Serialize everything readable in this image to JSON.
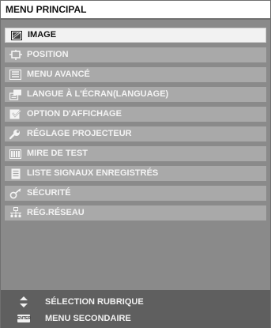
{
  "title": "MENU PRINCIPAL",
  "menu": {
    "items": [
      {
        "label": "IMAGE",
        "icon": "image-icon",
        "selected": true
      },
      {
        "label": "POSITION",
        "icon": "position-icon"
      },
      {
        "label": "MENU AVANCÉ",
        "icon": "advanced-menu-icon"
      },
      {
        "label": "LANGUE À L'ÉCRAN(LANGUAGE)",
        "icon": "language-icon"
      },
      {
        "label": "OPTION D'AFFICHAGE",
        "icon": "display-option-icon"
      },
      {
        "label": "RÉGLAGE PROJECTEUR",
        "icon": "projector-setting-icon"
      },
      {
        "label": "MIRE DE TEST",
        "icon": "test-pattern-icon"
      },
      {
        "label": "LISTE SIGNAUX ENREGISTRÉS",
        "icon": "signal-list-icon"
      },
      {
        "label": "SÉCURITÉ",
        "icon": "security-key-icon"
      },
      {
        "label": "RÉG.RÉSEAU",
        "icon": "network-icon"
      }
    ]
  },
  "footer": {
    "select_label": "SÉLECTION RUBRIQUE",
    "select_icon": "up-down-arrows-icon",
    "submenu_label": "MENU SECONDAIRE",
    "submenu_icon": "enter-key-icon",
    "enter_key_text": "ENTER"
  },
  "colors": {
    "background": "#8a8a8a",
    "item": "#a9a9a9",
    "item_selected": "#f2f2f2",
    "footer": "#5f5f5f"
  }
}
